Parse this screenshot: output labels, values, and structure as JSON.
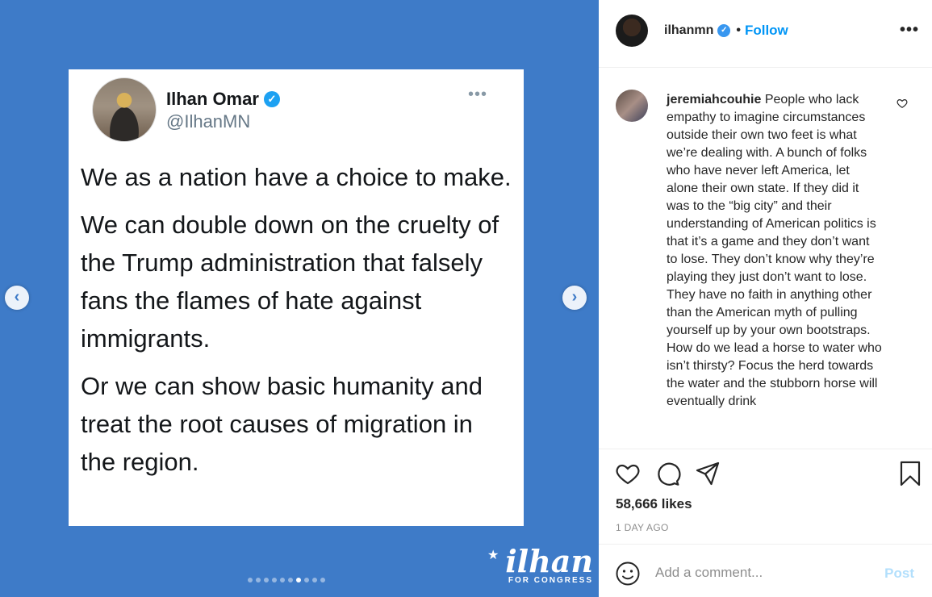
{
  "post": {
    "tweet": {
      "name": "Ilhan Omar",
      "handle": "@IlhanMN",
      "more": "•••",
      "paragraphs": [
        "We as a nation have a choice to make.",
        "We can double down on the cruelty of the Trump administration that falsely fans the flames of hate against immigrants.",
        "Or we can show basic humanity and treat the root causes of migration in the region."
      ]
    },
    "brand": {
      "main": "ilhan",
      "sub": "FOR CONGRESS"
    },
    "carousel": {
      "count": 10,
      "active_index": 6
    }
  },
  "header": {
    "username": "ilhanmn",
    "separator": "•",
    "follow_label": "Follow",
    "more": "•••"
  },
  "comment": {
    "username": "jeremiahcouhie",
    "text": "People who lack empathy to imagine circumstances outside their own two feet is what we’re dealing with. A bunch of folks who have never left America, let alone their own state. If they did it was to the “big city” and their understanding of American politics is that it’s a game and they don’t want to lose. They don’t know why they’re playing they just don’t want to lose. They have no faith in anything other than the American myth of pulling yourself up by your own bootstraps. How do we lead a horse to water who isn’t thirsty? Focus the herd towards the water and the stubborn horse will eventually drink"
  },
  "stats": {
    "likes": "58,666 likes",
    "time": "1 DAY AGO"
  },
  "composer": {
    "placeholder": "Add a comment...",
    "post_label": "Post"
  },
  "colors": {
    "media_bg": "#3e7bc8",
    "follow": "#0095f6",
    "verified": "#1da1f2"
  },
  "icons": [
    "prev-arrow-icon",
    "next-arrow-icon",
    "heart-icon",
    "comment-icon",
    "share-icon",
    "bookmark-icon",
    "emoji-icon",
    "more-icon",
    "verified-icon"
  ]
}
